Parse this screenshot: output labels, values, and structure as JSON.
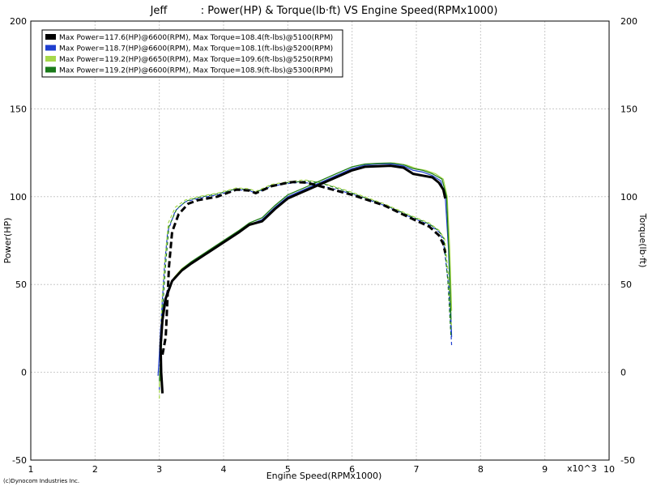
{
  "chart_data": {
    "type": "line",
    "title": "Jeff          : Power(HP) & Torque(lb·ft) VS Engine Speed(RPMx1000)",
    "xlabel": "Engine Speed(RPMx1000)",
    "ylabel_left": "Power(HP)",
    "ylabel_right": "Torque(lb·ft)",
    "x_multiplier_label": "x10^3",
    "footer": "(c)Dynocom Industries Inc.",
    "xlim": [
      1,
      10
    ],
    "ylim": [
      -50,
      200
    ],
    "x_ticks": [
      "1",
      "2",
      "3",
      "4",
      "5",
      "6",
      "7",
      "8",
      "9",
      "10"
    ],
    "y_ticks": [
      "-50",
      "0",
      "50",
      "100",
      "150",
      "200"
    ],
    "grid": true,
    "legend_position": "top-left",
    "series": [
      {
        "name": "Max Power=117.6(HP)@6600(RPM), Max Torque=108.4(ft-lbs)@5100(RPM)",
        "color": "#000000",
        "power": [
          [
            3.05,
            -12
          ],
          [
            3.03,
            0
          ],
          [
            3.02,
            15
          ],
          [
            3.05,
            30
          ],
          [
            3.1,
            42
          ],
          [
            3.2,
            52
          ],
          [
            3.35,
            58
          ],
          [
            3.5,
            62
          ],
          [
            3.75,
            68
          ],
          [
            4.0,
            74
          ],
          [
            4.25,
            80
          ],
          [
            4.4,
            84
          ],
          [
            4.6,
            86
          ],
          [
            4.8,
            93
          ],
          [
            5.0,
            99
          ],
          [
            5.25,
            103
          ],
          [
            5.5,
            107
          ],
          [
            5.75,
            111
          ],
          [
            6.0,
            115
          ],
          [
            6.2,
            117
          ],
          [
            6.4,
            117.3
          ],
          [
            6.6,
            117.6
          ],
          [
            6.8,
            116.5
          ],
          [
            6.95,
            113
          ],
          [
            7.1,
            112
          ],
          [
            7.25,
            111
          ],
          [
            7.35,
            108
          ],
          [
            7.42,
            104
          ],
          [
            7.45,
            99
          ]
        ],
        "torque": [
          [
            3.05,
            10
          ],
          [
            3.1,
            20
          ],
          [
            3.15,
            60
          ],
          [
            3.2,
            80
          ],
          [
            3.3,
            90
          ],
          [
            3.45,
            96
          ],
          [
            3.6,
            98
          ],
          [
            3.9,
            100
          ],
          [
            4.2,
            104
          ],
          [
            4.4,
            103.5
          ],
          [
            4.5,
            102
          ],
          [
            4.75,
            106
          ],
          [
            5.0,
            108
          ],
          [
            5.1,
            108.4
          ],
          [
            5.3,
            108
          ],
          [
            5.6,
            105
          ],
          [
            6.0,
            101
          ],
          [
            6.5,
            95
          ],
          [
            6.9,
            88
          ],
          [
            7.2,
            83
          ],
          [
            7.35,
            78
          ],
          [
            7.42,
            73
          ],
          [
            7.45,
            68
          ]
        ]
      },
      {
        "name": "Max Power=118.7(HP)@6600(RPM), Max Torque=108.1(ft-lbs)@5200(RPM)",
        "color": "#1f3fcf",
        "power": [
          [
            2.98,
            -2
          ],
          [
            3.0,
            10
          ],
          [
            3.02,
            25
          ],
          [
            3.06,
            38
          ],
          [
            3.12,
            46
          ],
          [
            3.22,
            53
          ],
          [
            3.35,
            58
          ],
          [
            3.5,
            62
          ],
          [
            3.75,
            68
          ],
          [
            4.0,
            74
          ],
          [
            4.25,
            80
          ],
          [
            4.4,
            84
          ],
          [
            4.6,
            87
          ],
          [
            4.8,
            94
          ],
          [
            5.0,
            100
          ],
          [
            5.25,
            104
          ],
          [
            5.5,
            108
          ],
          [
            5.75,
            112
          ],
          [
            6.0,
            116
          ],
          [
            6.2,
            118
          ],
          [
            6.4,
            118.5
          ],
          [
            6.6,
            118.7
          ],
          [
            6.8,
            117.5
          ],
          [
            6.95,
            115
          ],
          [
            7.1,
            114
          ],
          [
            7.25,
            112
          ],
          [
            7.38,
            109
          ],
          [
            7.45,
            100
          ],
          [
            7.5,
            70
          ],
          [
            7.53,
            40
          ],
          [
            7.55,
            20
          ]
        ],
        "torque": [
          [
            3.0,
            -10
          ],
          [
            3.03,
            30
          ],
          [
            3.08,
            60
          ],
          [
            3.13,
            80
          ],
          [
            3.25,
            92
          ],
          [
            3.4,
            97
          ],
          [
            3.6,
            99
          ],
          [
            3.9,
            101
          ],
          [
            4.2,
            104
          ],
          [
            4.4,
            103.5
          ],
          [
            4.5,
            102
          ],
          [
            4.75,
            106
          ],
          [
            5.0,
            107.5
          ],
          [
            5.2,
            108.1
          ],
          [
            5.4,
            107.5
          ],
          [
            5.7,
            104.5
          ],
          [
            6.0,
            101.5
          ],
          [
            6.5,
            95
          ],
          [
            6.9,
            88.5
          ],
          [
            7.2,
            84
          ],
          [
            7.35,
            80
          ],
          [
            7.42,
            75
          ],
          [
            7.5,
            50
          ],
          [
            7.55,
            15
          ]
        ]
      },
      {
        "name": "Max Power=119.2(HP)@6650(RPM), Max Torque=109.6(ft-lbs)@5250(RPM)",
        "color": "#a6d84a",
        "power": [
          [
            3.0,
            -8
          ],
          [
            3.02,
            5
          ],
          [
            3.03,
            20
          ],
          [
            3.07,
            36
          ],
          [
            3.13,
            45
          ],
          [
            3.23,
            54
          ],
          [
            3.35,
            59
          ],
          [
            3.5,
            63
          ],
          [
            3.75,
            69
          ],
          [
            4.0,
            75
          ],
          [
            4.25,
            81
          ],
          [
            4.4,
            85
          ],
          [
            4.6,
            88
          ],
          [
            4.8,
            95
          ],
          [
            5.0,
            101
          ],
          [
            5.25,
            105
          ],
          [
            5.5,
            109
          ],
          [
            5.75,
            113
          ],
          [
            6.0,
            117
          ],
          [
            6.2,
            118.5
          ],
          [
            6.45,
            119
          ],
          [
            6.65,
            119.2
          ],
          [
            6.85,
            118
          ],
          [
            7.0,
            116
          ],
          [
            7.15,
            115
          ],
          [
            7.3,
            113
          ],
          [
            7.42,
            110
          ],
          [
            7.48,
            100
          ],
          [
            7.52,
            70
          ],
          [
            7.55,
            35
          ]
        ],
        "torque": [
          [
            3.0,
            -15
          ],
          [
            3.04,
            40
          ],
          [
            3.09,
            65
          ],
          [
            3.14,
            85
          ],
          [
            3.25,
            94
          ],
          [
            3.4,
            98
          ],
          [
            3.6,
            100
          ],
          [
            3.9,
            102
          ],
          [
            4.2,
            105
          ],
          [
            4.4,
            104.5
          ],
          [
            4.5,
            103
          ],
          [
            4.75,
            107
          ],
          [
            5.0,
            108.5
          ],
          [
            5.25,
            109.6
          ],
          [
            5.45,
            108.5
          ],
          [
            5.75,
            105.5
          ],
          [
            6.0,
            102.5
          ],
          [
            6.5,
            96
          ],
          [
            6.9,
            89.5
          ],
          [
            7.2,
            85
          ],
          [
            7.35,
            81
          ],
          [
            7.44,
            76
          ],
          [
            7.5,
            55
          ],
          [
            7.55,
            25
          ]
        ]
      },
      {
        "name": "Max Power=119.2(HP)@6600(RPM), Max Torque=108.9(ft-lbs)@5300(RPM)",
        "color": "#1a7a1a",
        "power": [
          [
            3.0,
            -5
          ],
          [
            3.02,
            8
          ],
          [
            3.04,
            24
          ],
          [
            3.08,
            38
          ],
          [
            3.14,
            47
          ],
          [
            3.24,
            54
          ],
          [
            3.36,
            59
          ],
          [
            3.5,
            63
          ],
          [
            3.75,
            69
          ],
          [
            4.0,
            75
          ],
          [
            4.25,
            81
          ],
          [
            4.4,
            85
          ],
          [
            4.6,
            88
          ],
          [
            4.8,
            95
          ],
          [
            5.0,
            101
          ],
          [
            5.25,
            105
          ],
          [
            5.5,
            109
          ],
          [
            5.75,
            113
          ],
          [
            6.0,
            117
          ],
          [
            6.2,
            118.6
          ],
          [
            6.4,
            119
          ],
          [
            6.6,
            119.2
          ],
          [
            6.8,
            118.2
          ],
          [
            6.95,
            116
          ],
          [
            7.1,
            115
          ],
          [
            7.25,
            113
          ],
          [
            7.4,
            110
          ],
          [
            7.47,
            100
          ],
          [
            7.51,
            65
          ],
          [
            7.54,
            30
          ]
        ],
        "torque": [
          [
            3.02,
            -5
          ],
          [
            3.05,
            35
          ],
          [
            3.1,
            62
          ],
          [
            3.15,
            83
          ],
          [
            3.27,
            93
          ],
          [
            3.42,
            97.5
          ],
          [
            3.6,
            99.5
          ],
          [
            3.9,
            101.5
          ],
          [
            4.2,
            104.5
          ],
          [
            4.4,
            104
          ],
          [
            4.5,
            102.5
          ],
          [
            4.75,
            106.5
          ],
          [
            5.0,
            108
          ],
          [
            5.3,
            108.9
          ],
          [
            5.5,
            108
          ],
          [
            5.75,
            105
          ],
          [
            6.0,
            102
          ],
          [
            6.5,
            95.5
          ],
          [
            6.9,
            89
          ],
          [
            7.2,
            84.5
          ],
          [
            7.35,
            80.5
          ],
          [
            7.43,
            76
          ],
          [
            7.49,
            52
          ],
          [
            7.54,
            20
          ]
        ]
      }
    ]
  }
}
